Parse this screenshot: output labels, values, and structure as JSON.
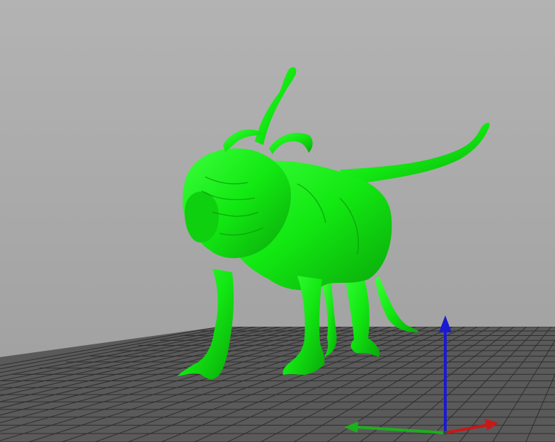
{
  "viewport": {
    "background_top": "#b3b3b3",
    "background_bottom": "#9e9e9e"
  },
  "build_plate": {
    "fill": "#5a5a5a",
    "grid_line": "#2e2e2e"
  },
  "model": {
    "color": "#12e812",
    "shadow": "#0aa80a",
    "highlight": "#4cff4c"
  },
  "axes": {
    "x_color": "#c8181a",
    "y_color": "#1cb01c",
    "z_color": "#1a1ad0"
  }
}
